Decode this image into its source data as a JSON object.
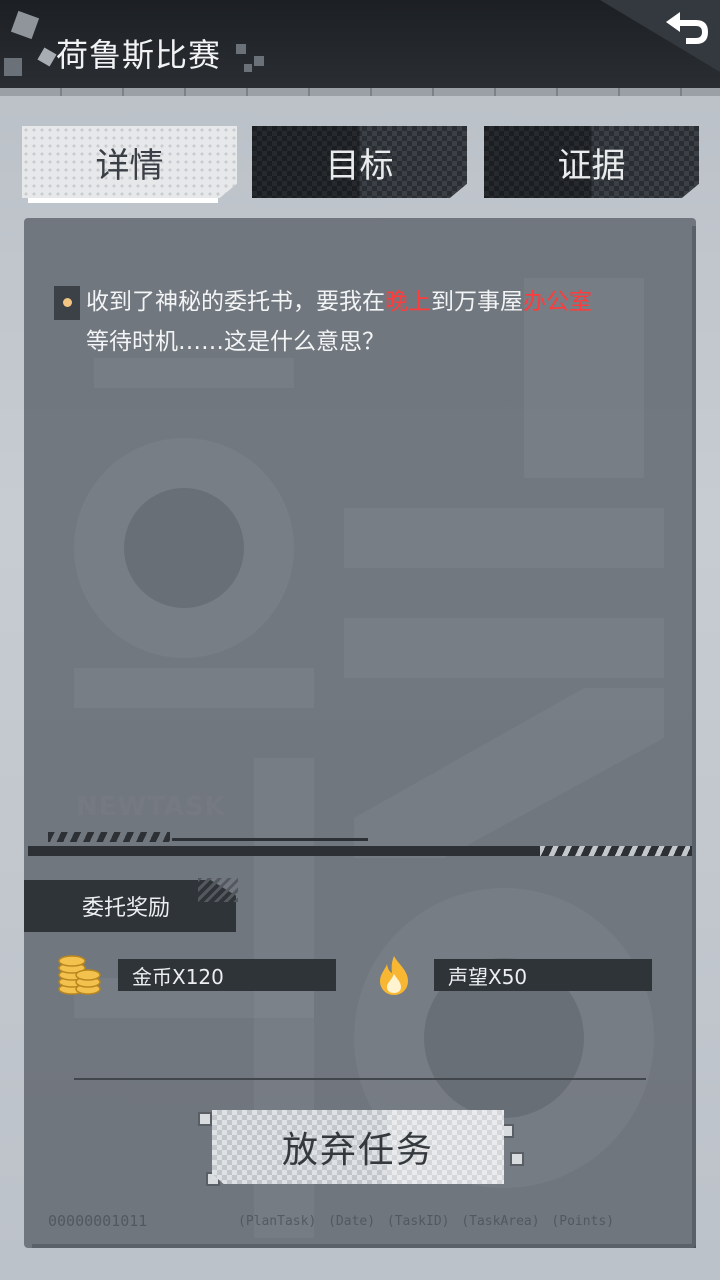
{
  "header": {
    "title": "荷鲁斯比赛"
  },
  "tabs": [
    {
      "label": "详情",
      "active": true
    },
    {
      "label": "目标",
      "active": false
    },
    {
      "label": "证据",
      "active": false
    }
  ],
  "description": {
    "part1": "收到了神秘的委托书，要我在",
    "highlight1": "晚上",
    "part2": "到万事屋",
    "highlight2": "办公室",
    "line2": "等待时机……这是什么意思？"
  },
  "watermark": "NEWTASK",
  "rewards": {
    "label": "委托奖励",
    "items": [
      {
        "icon": "coins-icon",
        "text": "金币X120"
      },
      {
        "icon": "flame-icon",
        "text": "声望X50"
      }
    ]
  },
  "abandon_button": "放弃任务",
  "footer": {
    "code": "00000001011",
    "tags": "(PlanTask) (Date) (TaskID) (TaskArea) (Points)"
  },
  "colors": {
    "highlight": "#ff3b3b",
    "bullet": "#f2c682",
    "coin": "#f2c14e",
    "flame": "#f7b733"
  }
}
